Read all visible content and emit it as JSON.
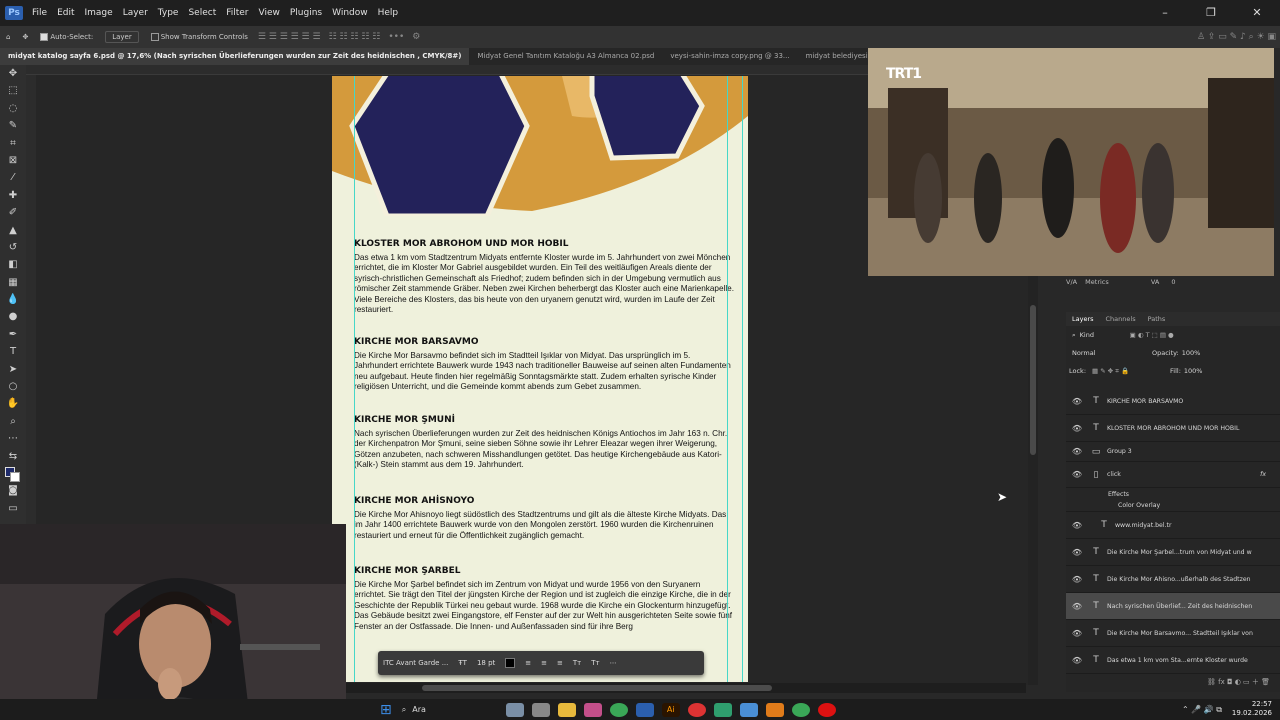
{
  "menu": [
    "File",
    "Edit",
    "Image",
    "Layer",
    "Type",
    "Select",
    "Filter",
    "View",
    "Plugins",
    "Window",
    "Help"
  ],
  "options": {
    "auto_select": "Auto-Select:",
    "layer": "Layer",
    "transform": "Show Transform Controls"
  },
  "tabs": [
    "midyat katalog sayfa 6.psd @ 17,6% (Nach syrischen Überlieferungen wurden zur Zeit des heidnischen , CMYK/8#)",
    "Midyat Genel Tanıtım Kataloğu A3 Almanca 02.psd",
    "veysi-sahin-imza copy.png @ 33...",
    "midyat belediyesi çalış"
  ],
  "doc": {
    "s1_title": "KLOSTER MOR ABROHOM UND MOR HOBIL",
    "s1_body": "Das etwa 1 km vom Stadtzentrum Midyats entfernte Kloster wurde im 5. Jahrhundert von zwei Mönchen errichtet, die im Kloster Mor Gabriel ausgebildet wurden. Ein Teil des weitläufigen Areals diente der syrisch-christlichen Gemeinschaft als Friedhof; zudem befinden sich in der Umgebung vermutlich aus römischer Zeit stammende Gräber. Neben zwei Kirchen beherbergt das Kloster auch eine Marienkapelle. Viele Bereiche des Klosters, das bis heute von den uryanern genutzt wird, wurden im Laufe der Zeit restauriert.",
    "s2_title": "KIRCHE MOR BARSAVMO",
    "s2_body": "Die Kirche Mor Barsavmo befindet sich im Stadtteil Işıklar von Midyat. Das ursprünglich im 5. Jahrhundert errichtete Bauwerk wurde 1943 nach traditioneller Bauweise auf seinen alten Fundamenten neu aufgebaut. Heute finden hier regelmäßig Sonntagsmärkte statt. Zudem erhalten syrische Kinder religiösen Unterricht, und die Gemeinde kommt abends zum Gebet zusammen.",
    "s3_title": "KIRCHE MOR ŞMUNİ",
    "s3_body": "Nach syrischen Überlieferungen wurden zur Zeit des heidnischen Königs Antiochos im Jahr 163 n. Chr. der Kirchenpatron Mor Şmuni, seine sieben Söhne sowie ihr Lehrer Eleazar wegen ihrer Weigerung, Götzen anzubeten, nach schweren Misshandlungen getötet. Das heutige Kirchengebäude aus Katori-(Kalk-) Stein stammt aus dem 19. Jahrhundert.",
    "s4_title": "KIRCHE MOR AHİSNOYO",
    "s4_body": "Die Kirche Mor Ahisnoyo liegt südöstlich des Stadtzentrums und gilt als die älteste Kirche Midyats. Das im Jahr 1400 errichtete Bauwerk wurde von den Mongolen zerstört. 1960 wurden die Kirchenruinen restauriert und erneut für die Öffentlichkeit zugänglich gemacht.",
    "s5_title": "KIRCHE MOR ŞARBEL",
    "s5_body": "Die Kirche Mor Şarbel befindet sich im Zentrum von Midyat und wurde 1956 von den Suryanern errichtet. Sie trägt den Titel der jüngsten Kirche der Region und ist zugleich die einzige Kirche, die in der Geschichte der Republik Türkei neu gebaut wurde. 1968 wurde die Kirche ein Glockenturm hinzugefügt. Das Gebäude besitzt zwei Eingangstore, elf Fenster auf der zur Welt hin ausgerichteten Seite sowie fünf Fenster an der Ostfassade. Die Innen- und Außenfassaden sind für ihre Berg"
  },
  "textbar": {
    "font": "ITC Avant Garde ...",
    "size": "18 pt"
  },
  "video": {
    "logo": "TRT1"
  },
  "metrics": {
    "label": "Metrics",
    "va": "VA",
    "value": "0"
  },
  "layers": {
    "tabs": [
      "Layers",
      "Channels",
      "Paths"
    ],
    "kind": "Kind",
    "blend": "Normal",
    "opacity_label": "Opacity:",
    "opacity": "100%",
    "lock": "Lock:",
    "fill_label": "Fill:",
    "fill": "100%",
    "rows": [
      "KIRCHE MOR BARSAVMO",
      "KLOSTER MOR ABROHOM UND MOR HOBIL",
      "Group 3",
      "click",
      "Effects",
      "Color Overlay",
      "www.midyat.bel.tr",
      "Die Kirche Mor Şarbel...trum von Midyat und w",
      "Die Kirche Mor Ahisno...ußerhalb des Stadtzen",
      "Nach syrischen Überlief... Zeit des heidnischen",
      "Die Kirche Mor Barsavmo... Stadtteil Işıklar von",
      "Das etwa 1 km vom Sta...ernte Kloster wurde"
    ]
  },
  "taskbar": {
    "search": "Ara",
    "time": "22:57",
    "date": "19.02.2026"
  }
}
